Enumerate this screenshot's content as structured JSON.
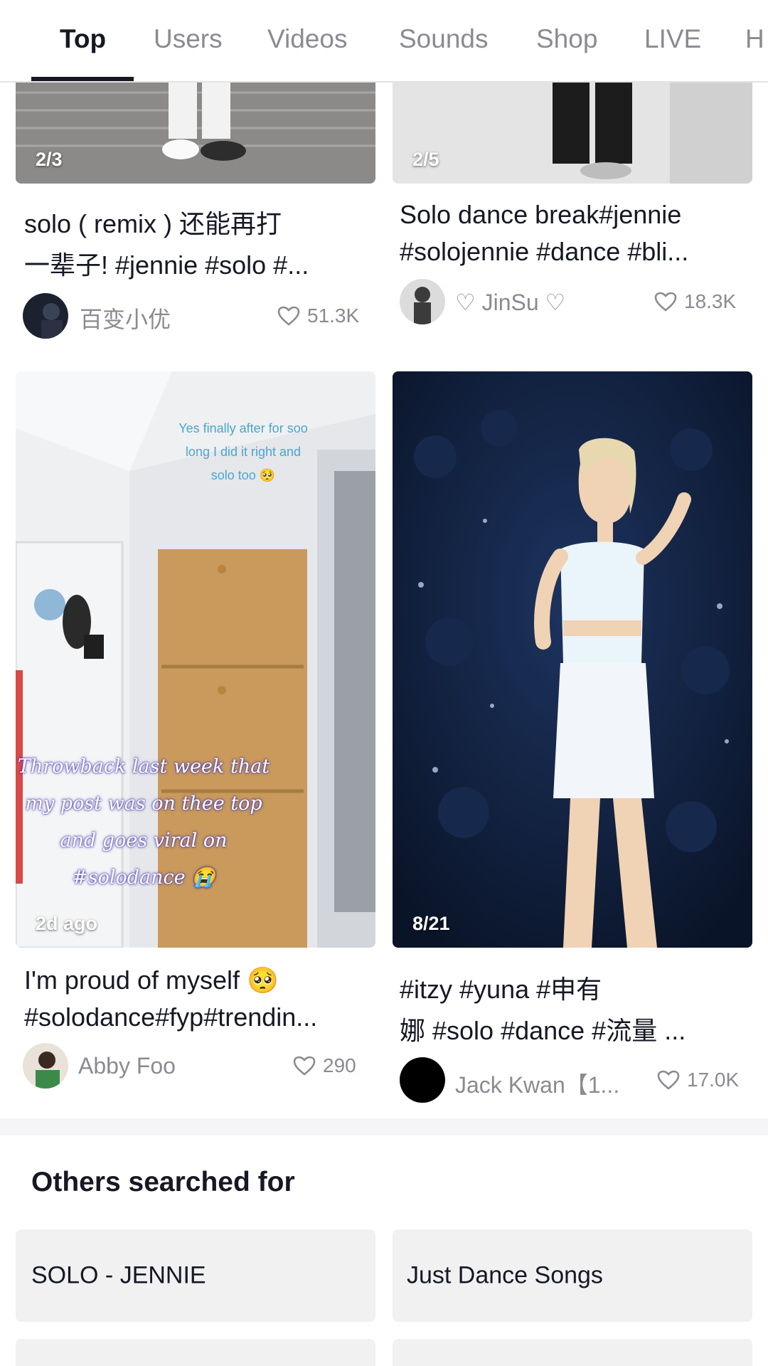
{
  "tabs": [
    {
      "label": "Top",
      "active": true
    },
    {
      "label": "Users"
    },
    {
      "label": "Videos"
    },
    {
      "label": "Sounds"
    },
    {
      "label": "Shop"
    },
    {
      "label": "LIVE"
    },
    {
      "label": "H"
    }
  ],
  "cards": [
    {
      "badge": "2/3",
      "caption_lines": [
        "solo ( remix ) 还能再打",
        "一辈子! #jennie #solo #..."
      ],
      "author": "百变小优",
      "likes": "51.3K"
    },
    {
      "badge": "2/5",
      "caption_lines": [
        "Solo dance break#jennie",
        "#solojennie #dance #bli..."
      ],
      "author": "♡ JinSu ♡",
      "likes": "18.3K"
    },
    {
      "badge": "2d ago",
      "overlay_top": [
        "Yes finally after for soo",
        "long I did it right and",
        "solo too 🥺"
      ],
      "overlay_script": [
        "Throwback last week that",
        "my post was on thee top",
        "and goes viral on",
        "#solodance 😭"
      ],
      "caption_lines": [
        "I'm proud of myself 🥺",
        "#solodance#fyp#trendin..."
      ],
      "author": "Abby Foo",
      "likes": "290"
    },
    {
      "badge": "8/21",
      "caption_lines": [
        "#itzy #yuna #申有",
        "娜 #solo #dance #流量 ..."
      ],
      "author": "Jack Kwan【1...",
      "likes": "17.0K"
    }
  ],
  "others": {
    "title": "Others searched for",
    "items": [
      "SOLO - JENNIE",
      "Just Dance Songs"
    ]
  },
  "icons": {
    "like": "heart-outline-icon"
  },
  "colors": {
    "text": "#161823",
    "muted": "#8a8b91",
    "chip": "#f1f1f2"
  }
}
